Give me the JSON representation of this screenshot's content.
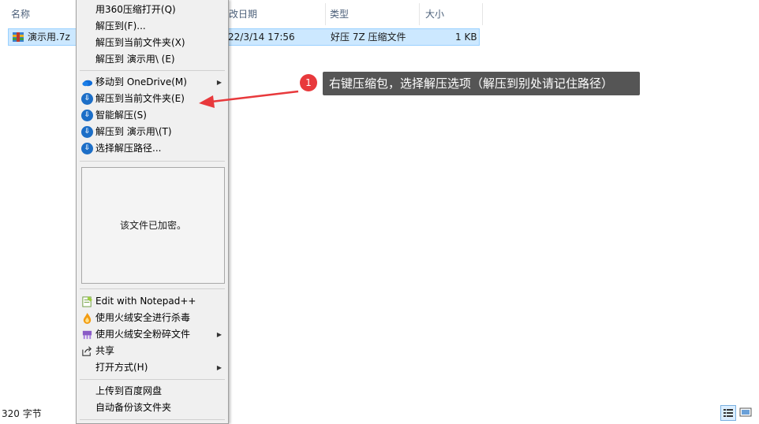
{
  "columns": {
    "name": "名称",
    "date": "改日期",
    "type": "类型",
    "size": "大小"
  },
  "file": {
    "name": "演示用.7z",
    "date": "22/3/14 17:56",
    "type": "好压 7Z 压缩文件",
    "size": "1 KB"
  },
  "menu": {
    "group1": [
      {
        "label": "用360压缩打开(Q)"
      },
      {
        "label": "解压到(F)..."
      },
      {
        "label": "解压到当前文件夹(X)"
      },
      {
        "label": "解压到 演示用\\ (E)"
      }
    ],
    "group2": [
      {
        "label": "移动到 OneDrive(M)",
        "icon": "onedrive-icon",
        "submenu": true
      },
      {
        "label": "解压到当前文件夹(E)",
        "icon": "haozip-icon"
      },
      {
        "label": "智能解压(S)",
        "icon": "haozip-icon"
      },
      {
        "label": "解压到 演示用\\(T)",
        "icon": "haozip-icon"
      },
      {
        "label": "选择解压路径...",
        "icon": "haozip-icon"
      }
    ],
    "preview_text": "该文件已加密。",
    "group3": [
      {
        "label": "Edit with Notepad++",
        "icon": "notepadpp-icon"
      },
      {
        "label": "使用火绒安全进行杀毒",
        "icon": "huorong-icon"
      },
      {
        "label": "使用火绒安全粉碎文件",
        "icon": "shredder-icon",
        "submenu": true
      },
      {
        "label": "共享",
        "icon": "share-icon"
      },
      {
        "label": "打开方式(H)",
        "submenu": true
      }
    ],
    "group4": [
      {
        "label": "上传到百度网盘"
      },
      {
        "label": "自动备份该文件夹"
      }
    ]
  },
  "annotation": {
    "number": "1",
    "text": "右键压缩包，选择解压选项（解压到别处请记住路径）",
    "color": "#e8393c"
  },
  "status": {
    "text": "320 字节"
  }
}
